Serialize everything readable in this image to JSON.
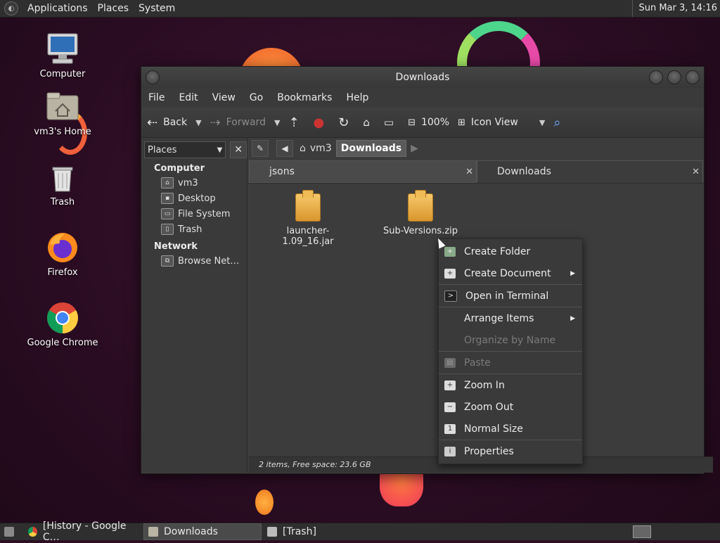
{
  "top_panel": {
    "menus": [
      "Applications",
      "Places",
      "System"
    ],
    "clock": "Sun Mar  3, 14:16"
  },
  "desktop_icons": [
    {
      "label": "Computer",
      "icon": "computer-icon"
    },
    {
      "label": "vm3's Home",
      "icon": "home-folder-icon"
    },
    {
      "label": "Trash",
      "icon": "trash-icon"
    },
    {
      "label": "Firefox",
      "icon": "firefox-icon"
    },
    {
      "label": "Google Chrome",
      "icon": "chrome-icon"
    }
  ],
  "window": {
    "title": "Downloads",
    "menubar": [
      "File",
      "Edit",
      "View",
      "Go",
      "Bookmarks",
      "Help"
    ],
    "toolbar": {
      "back": "Back",
      "forward": "Forward",
      "zoom": "100%",
      "view_mode": "Icon View"
    },
    "sidebar": {
      "combo": "Places",
      "computer_heading": "Computer",
      "computer_items": [
        "vm3",
        "Desktop",
        "File System",
        "Trash"
      ],
      "network_heading": "Network",
      "network_items": [
        "Browse Net…"
      ]
    },
    "pathbar": [
      "vm3",
      "Downloads"
    ],
    "tabs": [
      "jsons",
      "Downloads"
    ],
    "files": [
      {
        "name": "launcher-1.09_16.jar"
      },
      {
        "name": "Sub-Versions.zip"
      }
    ],
    "status": "2 items, Free space: 23.6 GB"
  },
  "context_menu": {
    "items": [
      {
        "label": "Create Folder",
        "enabled": true
      },
      {
        "label": "Create Document",
        "enabled": true,
        "submenu": true
      },
      {
        "label": "Open in Terminal",
        "enabled": true
      },
      {
        "label": "Arrange Items",
        "enabled": true,
        "submenu": true
      },
      {
        "label": "Organize by Name",
        "enabled": false
      },
      {
        "label": "Paste",
        "enabled": false
      },
      {
        "label": "Zoom In",
        "enabled": true
      },
      {
        "label": "Zoom Out",
        "enabled": true
      },
      {
        "label": "Normal Size",
        "enabled": true
      },
      {
        "label": "Properties",
        "enabled": true
      }
    ]
  },
  "taskbar": {
    "tasks": [
      "[History - Google C…",
      "Downloads",
      "[Trash]"
    ]
  },
  "colors": {
    "panel": "#2f2f2f",
    "window_bg": "#3d3d3d",
    "desktop_bg": "#2c0f22",
    "folder_orange": "#f0bb55"
  }
}
